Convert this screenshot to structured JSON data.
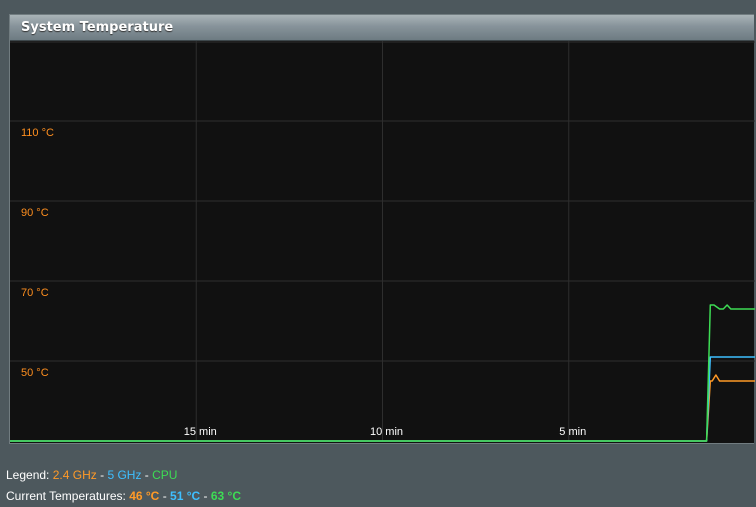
{
  "panel": {
    "title": "System Temperature"
  },
  "legend": {
    "label": "Legend:",
    "sep": "-",
    "items": [
      "2.4 GHz",
      "5 GHz",
      "CPU"
    ]
  },
  "current": {
    "label": "Current Temperatures:",
    "sep": "-",
    "values": [
      "46 °C",
      "51 °C",
      "63 °C"
    ]
  },
  "colors": {
    "ghz24": "#ff9a27",
    "ghz5": "#3ebfff",
    "cpu": "#3ddc54",
    "grid": "#2e2e2e",
    "tick": "#ff8f1f"
  },
  "chart_data": {
    "type": "line",
    "ylim": [
      30,
      130
    ],
    "y_ticks": [
      50,
      70,
      90,
      110
    ],
    "y_tick_labels": [
      "50 °C",
      "70 °C",
      "90 °C",
      "110 °C"
    ],
    "xlim": [
      -20,
      0
    ],
    "x_ticks": [
      -15,
      -10,
      -5
    ],
    "x_tick_labels": [
      "15 min",
      "10 min",
      "5 min"
    ],
    "grid": true,
    "series": [
      {
        "name": "2.4 GHz",
        "x": [
          -20,
          -1.3,
          -1.2,
          -1.15,
          -1.05,
          -0.95,
          -0.85,
          -0.6,
          0
        ],
        "y": [
          30,
          30,
          45,
          45,
          46.5,
          45,
          45,
          45,
          45
        ]
      },
      {
        "name": "5 GHz",
        "x": [
          -20,
          -1.3,
          -1.2,
          0
        ],
        "y": [
          30,
          30,
          51,
          51
        ]
      },
      {
        "name": "CPU",
        "x": [
          -20,
          -1.3,
          -1.2,
          -1.1,
          -0.95,
          -0.85,
          -0.75,
          -0.65,
          -0.55,
          -0.45,
          0
        ],
        "y": [
          30,
          30,
          64,
          64,
          63,
          63,
          64,
          63,
          63,
          63,
          63
        ]
      }
    ]
  }
}
